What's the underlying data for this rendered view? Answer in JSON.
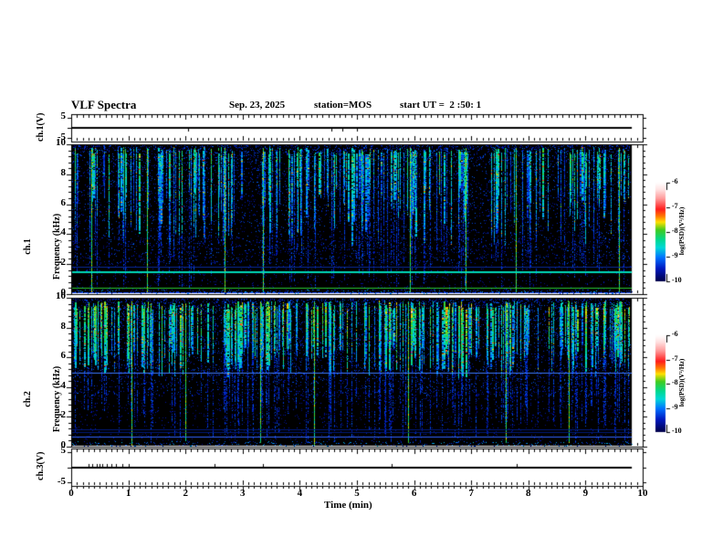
{
  "header": {
    "title": "VLF Spectra",
    "date": "Sep. 23, 2025",
    "station": "station=MOS",
    "start_ut": "start UT =  2 :50: 1"
  },
  "panels": {
    "strip1": {
      "axis_label": "ch.1(V)",
      "yticks": [
        "5",
        "-5"
      ]
    },
    "spec1": {
      "axis_label_channel": "ch.1",
      "axis_label_unit": "Frequency (kHz)",
      "yticks": [
        "10",
        "8",
        "6",
        "4",
        "2",
        "0"
      ]
    },
    "spec2": {
      "axis_label_channel": "ch.2",
      "axis_label_unit": "Frequency (kHz)",
      "yticks": [
        "10",
        "8",
        "6",
        "4",
        "2",
        "0"
      ]
    },
    "strip2": {
      "axis_label": "ch.3(V)",
      "yticks": [
        "5",
        "-5"
      ]
    }
  },
  "xaxis": {
    "label": "Time (min)",
    "ticks": [
      "0",
      "1",
      "2",
      "3",
      "4",
      "5",
      "6",
      "7",
      "8",
      "9",
      "10"
    ]
  },
  "colorbar": {
    "label": "log(PSD)(V²/Hz)",
    "ticks": [
      "-6",
      "-7",
      "-8",
      "-9",
      "-10"
    ],
    "gradient": [
      [
        0.0,
        "#ffffff"
      ],
      [
        0.07,
        "#ffe2e2"
      ],
      [
        0.16,
        "#ff9c9c"
      ],
      [
        0.27,
        "#ff1c1c"
      ],
      [
        0.34,
        "#ff7800"
      ],
      [
        0.4,
        "#ffe000"
      ],
      [
        0.48,
        "#3fcc1f"
      ],
      [
        0.58,
        "#00d890"
      ],
      [
        0.66,
        "#00d8d8"
      ],
      [
        0.76,
        "#0070ff"
      ],
      [
        0.87,
        "#0018c0"
      ],
      [
        1.0,
        "#000048"
      ]
    ]
  },
  "chart_data": [
    {
      "type": "line",
      "channel": "ch.1(V)",
      "panel": "top amplitude strip",
      "ylim_v": [
        -5,
        5
      ],
      "x_range_min": [
        0,
        10
      ],
      "x_data_end_min": 9.81,
      "signal": "flat trace at 0 V",
      "noise_blip_times_min": [
        2.05,
        4.55,
        4.75,
        5.0
      ]
    },
    {
      "type": "heatmap",
      "subtype": "vlf-spectrogram",
      "channel": "ch.1",
      "ylabel": "Frequency (kHz)",
      "ylim_khz": [
        0,
        10
      ],
      "x_range_min": [
        0,
        10
      ],
      "x_data_end_min": 9.81,
      "z_label": "log(PSD)(V²/Hz)",
      "z_range": [
        -10,
        -6
      ],
      "background": "black (below -10)",
      "seed": 7,
      "sferic_streaks": {
        "count": 250,
        "top_khz": [
          9.3,
          9.85
        ],
        "bottom_khz": [
          3.2,
          7.2
        ],
        "tail_prob": 0.45,
        "tail_to_khz": [
          0.2,
          2.8
        ],
        "base_t": [
          0.18,
          0.48
        ]
      },
      "strong_streak_times_min": [
        0.35,
        1.33,
        2.68,
        3.35,
        5.92,
        6.9,
        7.78,
        9.58
      ],
      "sparse_gaps_min": [
        [
          2.85,
          3.3
        ],
        [
          7.0,
          7.3
        ]
      ],
      "horizontal_tones": [
        {
          "freq_khz": 1.55,
          "color": "#00d8b8",
          "px": 2
        },
        {
          "freq_khz": 1.8,
          "color": "#0a2a9a",
          "px": 1
        },
        {
          "freq_khz": 0.45,
          "color": "#28c832",
          "px": 1
        },
        {
          "freq_khz": 0.15,
          "color": "#1c50ff",
          "px": 1
        }
      ],
      "bottom_band_khz": [
        0,
        0.25
      ]
    },
    {
      "type": "heatmap",
      "subtype": "vlf-spectrogram",
      "channel": "ch.2",
      "ylabel": "Frequency (kHz)",
      "ylim_khz": [
        0,
        10
      ],
      "x_range_min": [
        0,
        10
      ],
      "x_data_end_min": 9.81,
      "z_label": "log(PSD)(V²/Hz)",
      "z_range": [
        -10,
        -6
      ],
      "background": "black (below -10)",
      "seed": 13,
      "sferic_streaks": {
        "count": 330,
        "top_khz": [
          9.2,
          9.8
        ],
        "bottom_khz": [
          4.6,
          6.9
        ],
        "tail_prob": 0.5,
        "tail_to_khz": [
          0.2,
          3.0
        ],
        "base_t": [
          0.26,
          0.6
        ]
      },
      "strong_streak_times_min": [
        1.05,
        2.0,
        3.3,
        4.25,
        5.9,
        7.6,
        8.7
      ],
      "sparse_gaps_min": [
        [
          2.35,
          2.65
        ],
        [
          4.9,
          5.15
        ],
        [
          8.05,
          8.3
        ]
      ],
      "horizontal_tones": [
        {
          "freq_khz": 5.0,
          "color": "#3c78ff",
          "px": 1
        },
        {
          "freq_khz": 1.15,
          "color": "#001a78",
          "px": 1
        },
        {
          "freq_khz": 1.0,
          "color": "#001a78",
          "px": 1
        },
        {
          "freq_khz": 0.7,
          "color": "#3264ff",
          "px": 1
        }
      ],
      "bottom_band_khz": [
        0,
        0.3
      ]
    },
    {
      "type": "line",
      "channel": "ch.3(V)",
      "panel": "bottom amplitude strip",
      "ylim_v": [
        -5,
        5
      ],
      "x_range_min": [
        0,
        10
      ],
      "x_data_end_min": 9.81,
      "signal": "flat trace at 0 V",
      "noise_blip_times_min": [
        0.3,
        0.37,
        0.45,
        0.5,
        0.55,
        0.62,
        0.7,
        0.78,
        0.9,
        1.0,
        2.5,
        3.35,
        5.6,
        7.8
      ]
    }
  ]
}
